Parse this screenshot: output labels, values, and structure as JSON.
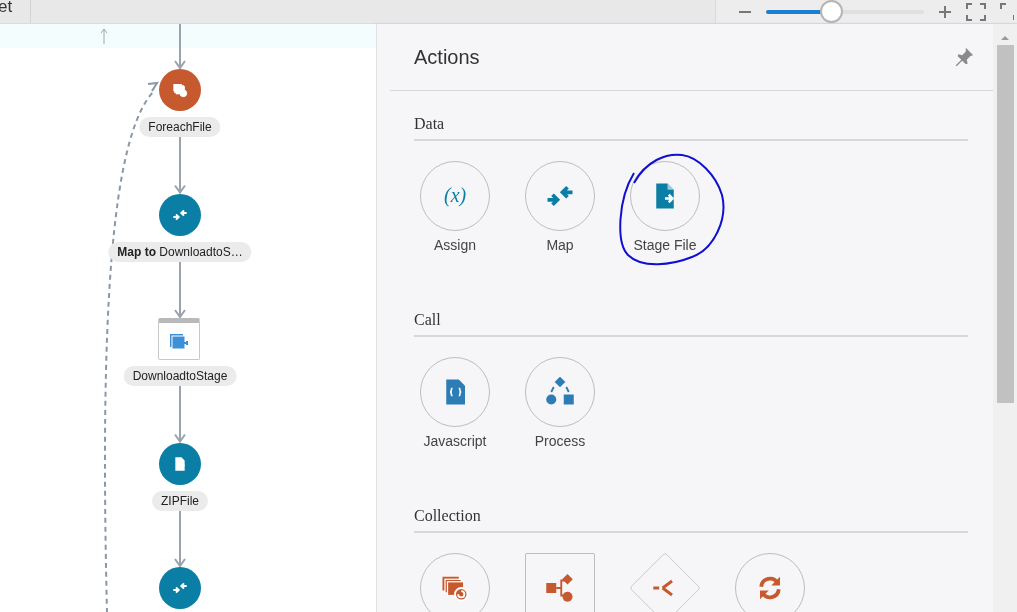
{
  "toolbar": {
    "title": "et",
    "zoom": {
      "level": 0.42
    }
  },
  "canvas": {
    "nodes": [
      {
        "kind": "foreach",
        "color": "#c65a2e",
        "label": "ForeachFile"
      },
      {
        "kind": "map",
        "color": "#0a7ea4",
        "label": "**Map to** DownloadtoS…"
      },
      {
        "kind": "download",
        "color": "#3d8fd8",
        "label": "DownloadtoStage"
      },
      {
        "kind": "stage",
        "color": "#0a7ea4",
        "label": "ZIPFile"
      },
      {
        "kind": "map",
        "color": "#0a7ea4"
      }
    ]
  },
  "panel": {
    "title": "Actions",
    "sections": [
      {
        "title": "Data",
        "items": [
          {
            "kind": "assign",
            "symbol": "(x)",
            "color": "#0a7ea4",
            "label": "Assign",
            "circled": false
          },
          {
            "kind": "map",
            "color": "#0a7ea4",
            "label": "Map",
            "circled": false
          },
          {
            "kind": "stage",
            "color": "#0a7ea4",
            "label": "Stage File",
            "circled": true
          }
        ]
      },
      {
        "title": "Call",
        "items": [
          {
            "kind": "javascript",
            "color": "#2c7db5",
            "label": "Javascript",
            "circled": false
          },
          {
            "kind": "process",
            "color": "#2c7db5",
            "label": "Process",
            "circled": false
          }
        ]
      },
      {
        "title": "Collection",
        "items": [
          {
            "kind": "foreach",
            "color": "#c65a2e",
            "circled": false
          },
          {
            "kind": "flow",
            "color": "#c65a2e",
            "circled": false
          },
          {
            "kind": "split",
            "color": "#c65a2e",
            "circled": false
          },
          {
            "kind": "loop",
            "color": "#c65a2e",
            "circled": false
          }
        ]
      }
    ]
  }
}
